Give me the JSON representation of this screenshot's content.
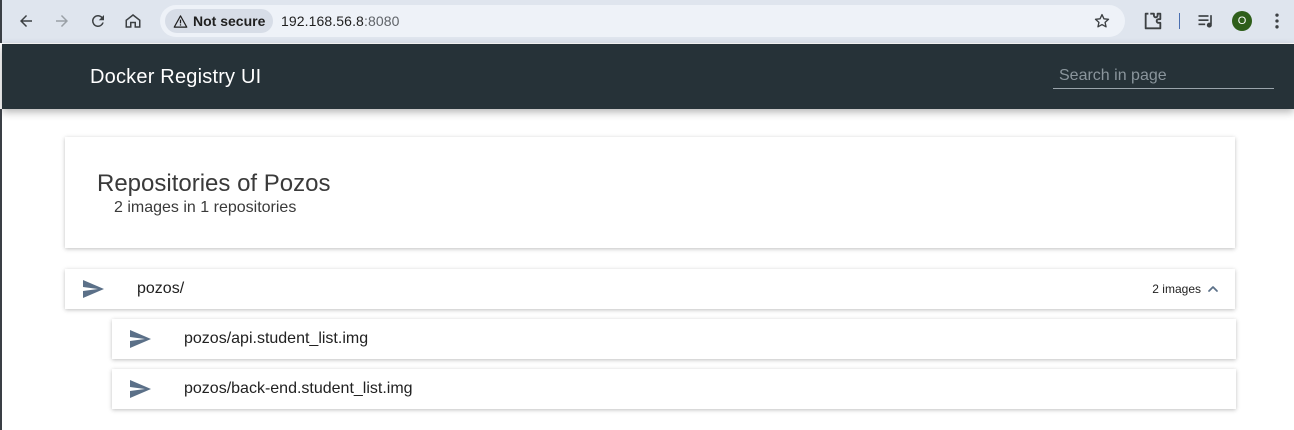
{
  "browser": {
    "security_label": "Not secure",
    "url_host": "192.168.56.8",
    "url_port": ":8080",
    "profile_initial": "O"
  },
  "app": {
    "title": "Docker Registry UI",
    "search_placeholder": "Search in page"
  },
  "catalog": {
    "title": "Repositories of Pozos",
    "subtitle": "2 images in 1 repositories"
  },
  "repository": {
    "name": "pozos/",
    "count_label": "2 images",
    "images": [
      {
        "name": "pozos/api.student_list.img"
      },
      {
        "name": "pozos/back-end.student_list.img"
      }
    ]
  },
  "colors": {
    "header_bg": "#263238",
    "send_icon": "#5b7088",
    "profile_bg": "#2e5e1a"
  },
  "icons": [
    "back-icon",
    "forward-icon",
    "reload-icon",
    "home-icon",
    "warning-icon",
    "star-icon",
    "extensions-icon",
    "media-icon",
    "kebab-menu-icon",
    "send-icon",
    "chevron-up-icon"
  ]
}
